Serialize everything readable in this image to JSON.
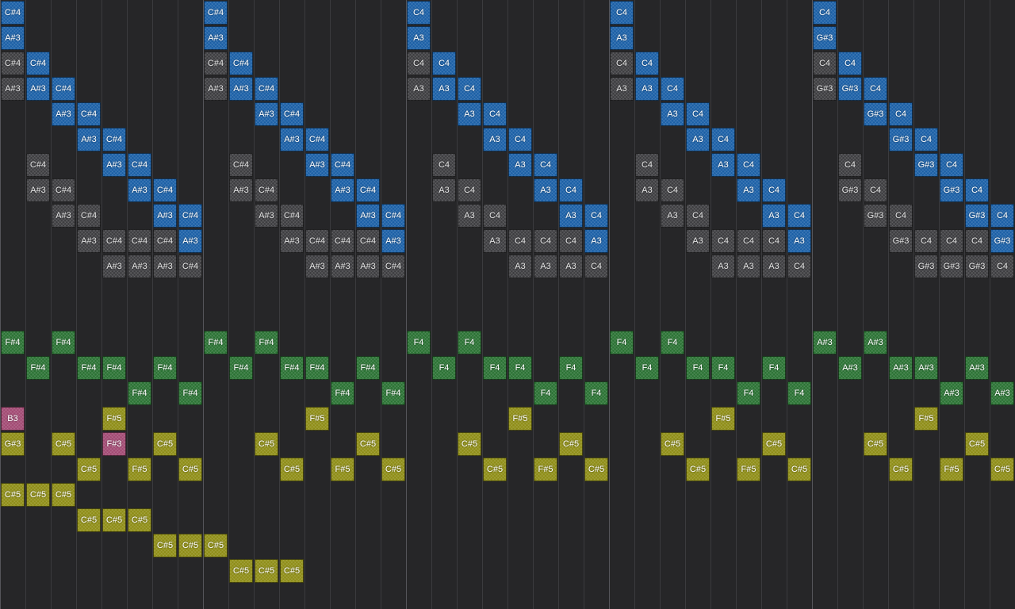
{
  "grid": {
    "columns": 40,
    "rows": 24,
    "bar_every": 8,
    "colors": {
      "background": "#262628",
      "blue": "#1a5fa6",
      "gray": "#3c3c3f",
      "green": "#2a7233",
      "yellow": "#8e8d16",
      "pink": "#a24a73"
    }
  },
  "notes": [
    {
      "c": 0,
      "r": 0,
      "t": "C#4",
      "k": "blue"
    },
    {
      "c": 0,
      "r": 1,
      "t": "A#3",
      "k": "blue"
    },
    {
      "c": 0,
      "r": 2,
      "t": "C#4",
      "k": "gray"
    },
    {
      "c": 1,
      "r": 2,
      "t": "C#4",
      "k": "blue"
    },
    {
      "c": 0,
      "r": 3,
      "t": "A#3",
      "k": "gray"
    },
    {
      "c": 1,
      "r": 3,
      "t": "A#3",
      "k": "blue"
    },
    {
      "c": 2,
      "r": 3,
      "t": "C#4",
      "k": "blue"
    },
    {
      "c": 2,
      "r": 4,
      "t": "A#3",
      "k": "blue"
    },
    {
      "c": 3,
      "r": 4,
      "t": "C#4",
      "k": "blue"
    },
    {
      "c": 3,
      "r": 5,
      "t": "A#3",
      "k": "blue"
    },
    {
      "c": 4,
      "r": 5,
      "t": "C#4",
      "k": "blue"
    },
    {
      "c": 1,
      "r": 6,
      "t": "C#4",
      "k": "gray"
    },
    {
      "c": 4,
      "r": 6,
      "t": "A#3",
      "k": "blue"
    },
    {
      "c": 5,
      "r": 6,
      "t": "C#4",
      "k": "blue"
    },
    {
      "c": 1,
      "r": 7,
      "t": "A#3",
      "k": "gray"
    },
    {
      "c": 2,
      "r": 7,
      "t": "C#4",
      "k": "gray"
    },
    {
      "c": 5,
      "r": 7,
      "t": "A#3",
      "k": "blue"
    },
    {
      "c": 6,
      "r": 7,
      "t": "C#4",
      "k": "blue"
    },
    {
      "c": 2,
      "r": 8,
      "t": "A#3",
      "k": "gray"
    },
    {
      "c": 3,
      "r": 8,
      "t": "C#4",
      "k": "gray"
    },
    {
      "c": 6,
      "r": 8,
      "t": "A#3",
      "k": "blue"
    },
    {
      "c": 7,
      "r": 8,
      "t": "C#4",
      "k": "blue"
    },
    {
      "c": 3,
      "r": 9,
      "t": "A#3",
      "k": "gray"
    },
    {
      "c": 4,
      "r": 9,
      "t": "C#4",
      "k": "gray"
    },
    {
      "c": 5,
      "r": 9,
      "t": "C#4",
      "k": "gray"
    },
    {
      "c": 6,
      "r": 9,
      "t": "C#4",
      "k": "gray"
    },
    {
      "c": 7,
      "r": 9,
      "t": "A#3",
      "k": "blue"
    },
    {
      "c": 4,
      "r": 10,
      "t": "A#3",
      "k": "gray"
    },
    {
      "c": 5,
      "r": 10,
      "t": "A#3",
      "k": "gray"
    },
    {
      "c": 6,
      "r": 10,
      "t": "A#3",
      "k": "gray"
    },
    {
      "c": 7,
      "r": 10,
      "t": "C#4",
      "k": "gray"
    },
    {
      "c": 8,
      "r": 0,
      "t": "C#4",
      "k": "blue"
    },
    {
      "c": 8,
      "r": 1,
      "t": "A#3",
      "k": "blue"
    },
    {
      "c": 8,
      "r": 2,
      "t": "C#4",
      "k": "gray"
    },
    {
      "c": 9,
      "r": 2,
      "t": "C#4",
      "k": "blue"
    },
    {
      "c": 8,
      "r": 3,
      "t": "A#3",
      "k": "gray"
    },
    {
      "c": 9,
      "r": 3,
      "t": "A#3",
      "k": "blue"
    },
    {
      "c": 10,
      "r": 3,
      "t": "C#4",
      "k": "blue"
    },
    {
      "c": 10,
      "r": 4,
      "t": "A#3",
      "k": "blue"
    },
    {
      "c": 11,
      "r": 4,
      "t": "C#4",
      "k": "blue"
    },
    {
      "c": 11,
      "r": 5,
      "t": "A#3",
      "k": "blue"
    },
    {
      "c": 12,
      "r": 5,
      "t": "C#4",
      "k": "blue"
    },
    {
      "c": 9,
      "r": 6,
      "t": "C#4",
      "k": "gray"
    },
    {
      "c": 12,
      "r": 6,
      "t": "A#3",
      "k": "blue"
    },
    {
      "c": 13,
      "r": 6,
      "t": "C#4",
      "k": "blue"
    },
    {
      "c": 9,
      "r": 7,
      "t": "A#3",
      "k": "gray"
    },
    {
      "c": 10,
      "r": 7,
      "t": "C#4",
      "k": "gray"
    },
    {
      "c": 13,
      "r": 7,
      "t": "A#3",
      "k": "blue"
    },
    {
      "c": 14,
      "r": 7,
      "t": "C#4",
      "k": "blue"
    },
    {
      "c": 10,
      "r": 8,
      "t": "A#3",
      "k": "gray"
    },
    {
      "c": 11,
      "r": 8,
      "t": "C#4",
      "k": "gray"
    },
    {
      "c": 14,
      "r": 8,
      "t": "A#3",
      "k": "blue"
    },
    {
      "c": 15,
      "r": 8,
      "t": "C#4",
      "k": "blue"
    },
    {
      "c": 11,
      "r": 9,
      "t": "A#3",
      "k": "gray"
    },
    {
      "c": 12,
      "r": 9,
      "t": "C#4",
      "k": "gray"
    },
    {
      "c": 13,
      "r": 9,
      "t": "C#4",
      "k": "gray"
    },
    {
      "c": 14,
      "r": 9,
      "t": "C#4",
      "k": "gray"
    },
    {
      "c": 15,
      "r": 9,
      "t": "A#3",
      "k": "blue"
    },
    {
      "c": 12,
      "r": 10,
      "t": "A#3",
      "k": "gray"
    },
    {
      "c": 13,
      "r": 10,
      "t": "A#3",
      "k": "gray"
    },
    {
      "c": 14,
      "r": 10,
      "t": "A#3",
      "k": "gray"
    },
    {
      "c": 15,
      "r": 10,
      "t": "C#4",
      "k": "gray"
    },
    {
      "c": 16,
      "r": 0,
      "t": "C4",
      "k": "blue"
    },
    {
      "c": 16,
      "r": 1,
      "t": "A3",
      "k": "blue"
    },
    {
      "c": 16,
      "r": 2,
      "t": "C4",
      "k": "gray"
    },
    {
      "c": 17,
      "r": 2,
      "t": "C4",
      "k": "blue"
    },
    {
      "c": 16,
      "r": 3,
      "t": "A3",
      "k": "gray"
    },
    {
      "c": 17,
      "r": 3,
      "t": "A3",
      "k": "blue"
    },
    {
      "c": 18,
      "r": 3,
      "t": "C4",
      "k": "blue"
    },
    {
      "c": 18,
      "r": 4,
      "t": "A3",
      "k": "blue"
    },
    {
      "c": 19,
      "r": 4,
      "t": "C4",
      "k": "blue"
    },
    {
      "c": 19,
      "r": 5,
      "t": "A3",
      "k": "blue"
    },
    {
      "c": 20,
      "r": 5,
      "t": "C4",
      "k": "blue"
    },
    {
      "c": 17,
      "r": 6,
      "t": "C4",
      "k": "gray"
    },
    {
      "c": 20,
      "r": 6,
      "t": "A3",
      "k": "blue"
    },
    {
      "c": 21,
      "r": 6,
      "t": "C4",
      "k": "blue"
    },
    {
      "c": 17,
      "r": 7,
      "t": "A3",
      "k": "gray"
    },
    {
      "c": 18,
      "r": 7,
      "t": "C4",
      "k": "gray"
    },
    {
      "c": 21,
      "r": 7,
      "t": "A3",
      "k": "blue"
    },
    {
      "c": 22,
      "r": 7,
      "t": "C4",
      "k": "blue"
    },
    {
      "c": 18,
      "r": 8,
      "t": "A3",
      "k": "gray"
    },
    {
      "c": 19,
      "r": 8,
      "t": "C4",
      "k": "gray"
    },
    {
      "c": 22,
      "r": 8,
      "t": "A3",
      "k": "blue"
    },
    {
      "c": 23,
      "r": 8,
      "t": "C4",
      "k": "blue"
    },
    {
      "c": 19,
      "r": 9,
      "t": "A3",
      "k": "gray"
    },
    {
      "c": 20,
      "r": 9,
      "t": "C4",
      "k": "gray"
    },
    {
      "c": 21,
      "r": 9,
      "t": "C4",
      "k": "gray"
    },
    {
      "c": 22,
      "r": 9,
      "t": "C4",
      "k": "gray"
    },
    {
      "c": 23,
      "r": 9,
      "t": "A3",
      "k": "blue"
    },
    {
      "c": 20,
      "r": 10,
      "t": "A3",
      "k": "gray"
    },
    {
      "c": 21,
      "r": 10,
      "t": "A3",
      "k": "gray"
    },
    {
      "c": 22,
      "r": 10,
      "t": "A3",
      "k": "gray"
    },
    {
      "c": 23,
      "r": 10,
      "t": "C4",
      "k": "gray"
    },
    {
      "c": 24,
      "r": 0,
      "t": "C4",
      "k": "blue"
    },
    {
      "c": 24,
      "r": 1,
      "t": "A3",
      "k": "blue"
    },
    {
      "c": 24,
      "r": 2,
      "t": "C4",
      "k": "gray"
    },
    {
      "c": 25,
      "r": 2,
      "t": "C4",
      "k": "blue"
    },
    {
      "c": 24,
      "r": 3,
      "t": "A3",
      "k": "gray"
    },
    {
      "c": 25,
      "r": 3,
      "t": "A3",
      "k": "blue"
    },
    {
      "c": 26,
      "r": 3,
      "t": "C4",
      "k": "blue"
    },
    {
      "c": 26,
      "r": 4,
      "t": "A3",
      "k": "blue"
    },
    {
      "c": 27,
      "r": 4,
      "t": "C4",
      "k": "blue"
    },
    {
      "c": 27,
      "r": 5,
      "t": "A3",
      "k": "blue"
    },
    {
      "c": 28,
      "r": 5,
      "t": "C4",
      "k": "blue"
    },
    {
      "c": 25,
      "r": 6,
      "t": "C4",
      "k": "gray"
    },
    {
      "c": 28,
      "r": 6,
      "t": "A3",
      "k": "blue"
    },
    {
      "c": 29,
      "r": 6,
      "t": "C4",
      "k": "blue"
    },
    {
      "c": 25,
      "r": 7,
      "t": "A3",
      "k": "gray"
    },
    {
      "c": 26,
      "r": 7,
      "t": "C4",
      "k": "gray"
    },
    {
      "c": 29,
      "r": 7,
      "t": "A3",
      "k": "blue"
    },
    {
      "c": 30,
      "r": 7,
      "t": "C4",
      "k": "blue"
    },
    {
      "c": 26,
      "r": 8,
      "t": "A3",
      "k": "gray"
    },
    {
      "c": 27,
      "r": 8,
      "t": "C4",
      "k": "gray"
    },
    {
      "c": 30,
      "r": 8,
      "t": "A3",
      "k": "blue"
    },
    {
      "c": 31,
      "r": 8,
      "t": "C4",
      "k": "blue"
    },
    {
      "c": 27,
      "r": 9,
      "t": "A3",
      "k": "gray"
    },
    {
      "c": 28,
      "r": 9,
      "t": "C4",
      "k": "gray"
    },
    {
      "c": 29,
      "r": 9,
      "t": "C4",
      "k": "gray"
    },
    {
      "c": 30,
      "r": 9,
      "t": "C4",
      "k": "gray"
    },
    {
      "c": 31,
      "r": 9,
      "t": "A3",
      "k": "blue"
    },
    {
      "c": 28,
      "r": 10,
      "t": "A3",
      "k": "gray"
    },
    {
      "c": 29,
      "r": 10,
      "t": "A3",
      "k": "gray"
    },
    {
      "c": 30,
      "r": 10,
      "t": "A3",
      "k": "gray"
    },
    {
      "c": 31,
      "r": 10,
      "t": "C4",
      "k": "gray"
    },
    {
      "c": 32,
      "r": 0,
      "t": "C4",
      "k": "blue"
    },
    {
      "c": 32,
      "r": 1,
      "t": "G#3",
      "k": "blue"
    },
    {
      "c": 32,
      "r": 2,
      "t": "C4",
      "k": "gray"
    },
    {
      "c": 33,
      "r": 2,
      "t": "C4",
      "k": "blue"
    },
    {
      "c": 32,
      "r": 3,
      "t": "G#3",
      "k": "gray"
    },
    {
      "c": 33,
      "r": 3,
      "t": "G#3",
      "k": "blue"
    },
    {
      "c": 34,
      "r": 3,
      "t": "C4",
      "k": "blue"
    },
    {
      "c": 34,
      "r": 4,
      "t": "G#3",
      "k": "blue"
    },
    {
      "c": 35,
      "r": 4,
      "t": "C4",
      "k": "blue"
    },
    {
      "c": 35,
      "r": 5,
      "t": "G#3",
      "k": "blue"
    },
    {
      "c": 36,
      "r": 5,
      "t": "C4",
      "k": "blue"
    },
    {
      "c": 33,
      "r": 6,
      "t": "C4",
      "k": "gray"
    },
    {
      "c": 36,
      "r": 6,
      "t": "G#3",
      "k": "blue"
    },
    {
      "c": 37,
      "r": 6,
      "t": "C4",
      "k": "blue"
    },
    {
      "c": 33,
      "r": 7,
      "t": "G#3",
      "k": "gray"
    },
    {
      "c": 34,
      "r": 7,
      "t": "C4",
      "k": "gray"
    },
    {
      "c": 37,
      "r": 7,
      "t": "G#3",
      "k": "blue"
    },
    {
      "c": 38,
      "r": 7,
      "t": "C4",
      "k": "blue"
    },
    {
      "c": 34,
      "r": 8,
      "t": "G#3",
      "k": "gray"
    },
    {
      "c": 35,
      "r": 8,
      "t": "C4",
      "k": "gray"
    },
    {
      "c": 38,
      "r": 8,
      "t": "G#3",
      "k": "blue"
    },
    {
      "c": 39,
      "r": 8,
      "t": "C4",
      "k": "blue"
    },
    {
      "c": 35,
      "r": 9,
      "t": "G#3",
      "k": "gray"
    },
    {
      "c": 36,
      "r": 9,
      "t": "C4",
      "k": "gray"
    },
    {
      "c": 37,
      "r": 9,
      "t": "C4",
      "k": "gray"
    },
    {
      "c": 38,
      "r": 9,
      "t": "C4",
      "k": "gray"
    },
    {
      "c": 39,
      "r": 9,
      "t": "G#3",
      "k": "blue"
    },
    {
      "c": 36,
      "r": 10,
      "t": "G#3",
      "k": "gray"
    },
    {
      "c": 37,
      "r": 10,
      "t": "G#3",
      "k": "gray"
    },
    {
      "c": 38,
      "r": 10,
      "t": "G#3",
      "k": "gray"
    },
    {
      "c": 39,
      "r": 10,
      "t": "C4",
      "k": "gray"
    },
    {
      "c": 0,
      "r": 13,
      "t": "F#4",
      "k": "green"
    },
    {
      "c": 2,
      "r": 13,
      "t": "F#4",
      "k": "green"
    },
    {
      "c": 1,
      "r": 14,
      "t": "F#4",
      "k": "green"
    },
    {
      "c": 3,
      "r": 14,
      "t": "F#4",
      "k": "green"
    },
    {
      "c": 4,
      "r": 14,
      "t": "F#4",
      "k": "green"
    },
    {
      "c": 6,
      "r": 14,
      "t": "F#4",
      "k": "green"
    },
    {
      "c": 5,
      "r": 15,
      "t": "F#4",
      "k": "green"
    },
    {
      "c": 7,
      "r": 15,
      "t": "F#4",
      "k": "green"
    },
    {
      "c": 8,
      "r": 13,
      "t": "F#4",
      "k": "green"
    },
    {
      "c": 10,
      "r": 13,
      "t": "F#4",
      "k": "green"
    },
    {
      "c": 9,
      "r": 14,
      "t": "F#4",
      "k": "green"
    },
    {
      "c": 11,
      "r": 14,
      "t": "F#4",
      "k": "green"
    },
    {
      "c": 12,
      "r": 14,
      "t": "F#4",
      "k": "green"
    },
    {
      "c": 14,
      "r": 14,
      "t": "F#4",
      "k": "green"
    },
    {
      "c": 13,
      "r": 15,
      "t": "F#4",
      "k": "green"
    },
    {
      "c": 15,
      "r": 15,
      "t": "F#4",
      "k": "green"
    },
    {
      "c": 16,
      "r": 13,
      "t": "F4",
      "k": "green"
    },
    {
      "c": 18,
      "r": 13,
      "t": "F4",
      "k": "green"
    },
    {
      "c": 17,
      "r": 14,
      "t": "F4",
      "k": "green"
    },
    {
      "c": 19,
      "r": 14,
      "t": "F4",
      "k": "green"
    },
    {
      "c": 20,
      "r": 14,
      "t": "F4",
      "k": "green"
    },
    {
      "c": 22,
      "r": 14,
      "t": "F4",
      "k": "green"
    },
    {
      "c": 21,
      "r": 15,
      "t": "F4",
      "k": "green"
    },
    {
      "c": 23,
      "r": 15,
      "t": "F4",
      "k": "green"
    },
    {
      "c": 24,
      "r": 13,
      "t": "F4",
      "k": "green"
    },
    {
      "c": 26,
      "r": 13,
      "t": "F4",
      "k": "green"
    },
    {
      "c": 25,
      "r": 14,
      "t": "F4",
      "k": "green"
    },
    {
      "c": 27,
      "r": 14,
      "t": "F4",
      "k": "green"
    },
    {
      "c": 28,
      "r": 14,
      "t": "F4",
      "k": "green"
    },
    {
      "c": 30,
      "r": 14,
      "t": "F4",
      "k": "green"
    },
    {
      "c": 29,
      "r": 15,
      "t": "F4",
      "k": "green"
    },
    {
      "c": 31,
      "r": 15,
      "t": "F4",
      "k": "green"
    },
    {
      "c": 32,
      "r": 13,
      "t": "A#3",
      "k": "green"
    },
    {
      "c": 34,
      "r": 13,
      "t": "A#3",
      "k": "green"
    },
    {
      "c": 33,
      "r": 14,
      "t": "A#3",
      "k": "green"
    },
    {
      "c": 35,
      "r": 14,
      "t": "A#3",
      "k": "green"
    },
    {
      "c": 36,
      "r": 14,
      "t": "A#3",
      "k": "green"
    },
    {
      "c": 38,
      "r": 14,
      "t": "A#3",
      "k": "green"
    },
    {
      "c": 37,
      "r": 15,
      "t": "A#3",
      "k": "green"
    },
    {
      "c": 39,
      "r": 15,
      "t": "A#3",
      "k": "green"
    },
    {
      "c": 0,
      "r": 16,
      "t": "B3",
      "k": "pink"
    },
    {
      "c": 4,
      "r": 17,
      "t": "F#3",
      "k": "pink"
    },
    {
      "c": 4,
      "r": 16,
      "t": "F#5",
      "k": "yellow"
    },
    {
      "c": 12,
      "r": 16,
      "t": "F#5",
      "k": "yellow"
    },
    {
      "c": 20,
      "r": 16,
      "t": "F#5",
      "k": "yellow"
    },
    {
      "c": 28,
      "r": 16,
      "t": "F#5",
      "k": "yellow"
    },
    {
      "c": 36,
      "r": 16,
      "t": "F#5",
      "k": "yellow"
    },
    {
      "c": 0,
      "r": 17,
      "t": "G#3",
      "k": "yellow"
    },
    {
      "c": 2,
      "r": 17,
      "t": "C#5",
      "k": "yellow"
    },
    {
      "c": 6,
      "r": 17,
      "t": "C#5",
      "k": "yellow"
    },
    {
      "c": 10,
      "r": 17,
      "t": "C#5",
      "k": "yellow"
    },
    {
      "c": 14,
      "r": 17,
      "t": "C#5",
      "k": "yellow"
    },
    {
      "c": 18,
      "r": 17,
      "t": "C#5",
      "k": "yellow"
    },
    {
      "c": 22,
      "r": 17,
      "t": "C#5",
      "k": "yellow"
    },
    {
      "c": 26,
      "r": 17,
      "t": "C#5",
      "k": "yellow"
    },
    {
      "c": 30,
      "r": 17,
      "t": "C#5",
      "k": "yellow"
    },
    {
      "c": 34,
      "r": 17,
      "t": "C#5",
      "k": "yellow"
    },
    {
      "c": 38,
      "r": 17,
      "t": "C#5",
      "k": "yellow"
    },
    {
      "c": 3,
      "r": 18,
      "t": "C#5",
      "k": "yellow"
    },
    {
      "c": 5,
      "r": 18,
      "t": "F#5",
      "k": "yellow"
    },
    {
      "c": 7,
      "r": 18,
      "t": "C#5",
      "k": "yellow"
    },
    {
      "c": 11,
      "r": 18,
      "t": "C#5",
      "k": "yellow"
    },
    {
      "c": 13,
      "r": 18,
      "t": "F#5",
      "k": "yellow"
    },
    {
      "c": 15,
      "r": 18,
      "t": "C#5",
      "k": "yellow"
    },
    {
      "c": 19,
      "r": 18,
      "t": "C#5",
      "k": "yellow"
    },
    {
      "c": 21,
      "r": 18,
      "t": "F#5",
      "k": "yellow"
    },
    {
      "c": 23,
      "r": 18,
      "t": "C#5",
      "k": "yellow"
    },
    {
      "c": 27,
      "r": 18,
      "t": "C#5",
      "k": "yellow"
    },
    {
      "c": 29,
      "r": 18,
      "t": "F#5",
      "k": "yellow"
    },
    {
      "c": 31,
      "r": 18,
      "t": "C#5",
      "k": "yellow"
    },
    {
      "c": 35,
      "r": 18,
      "t": "C#5",
      "k": "yellow"
    },
    {
      "c": 37,
      "r": 18,
      "t": "F#5",
      "k": "yellow"
    },
    {
      "c": 39,
      "r": 18,
      "t": "C#5",
      "k": "yellow"
    },
    {
      "c": 0,
      "r": 19,
      "t": "C#5",
      "k": "yellow"
    },
    {
      "c": 1,
      "r": 19,
      "t": "C#5",
      "k": "yellow"
    },
    {
      "c": 2,
      "r": 19,
      "t": "C#5",
      "k": "yellow"
    },
    {
      "c": 3,
      "r": 20,
      "t": "C#5",
      "k": "yellow"
    },
    {
      "c": 4,
      "r": 20,
      "t": "C#5",
      "k": "yellow"
    },
    {
      "c": 5,
      "r": 20,
      "t": "C#5",
      "k": "yellow"
    },
    {
      "c": 6,
      "r": 21,
      "t": "C#5",
      "k": "yellow"
    },
    {
      "c": 7,
      "r": 21,
      "t": "C#5",
      "k": "yellow"
    },
    {
      "c": 8,
      "r": 21,
      "t": "C#5",
      "k": "yellow"
    },
    {
      "c": 9,
      "r": 22,
      "t": "C#5",
      "k": "yellow"
    },
    {
      "c": 10,
      "r": 22,
      "t": "C#5",
      "k": "yellow"
    },
    {
      "c": 11,
      "r": 22,
      "t": "C#5",
      "k": "yellow"
    }
  ]
}
